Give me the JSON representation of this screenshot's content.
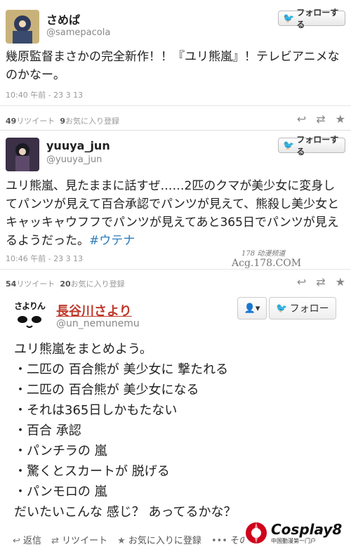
{
  "tweets": [
    {
      "name": "さめぱ",
      "handle": "@samepacola",
      "follow_label": "フォローする",
      "text": "幾原監督まさかの完全新作！！『ユリ熊嵐』！テレビアニメなのかなー。",
      "time": "10:40 午前 - 23 3 13",
      "retweets": "49",
      "retweets_label": "リツイート",
      "favs": "9",
      "favs_label": "お気に入り登録"
    },
    {
      "name": "yuuya_jun",
      "handle": "@yuuya_jun",
      "follow_label": "フォローする",
      "text": "ユリ熊嵐、見たままに話すぜ……2匹のクマが美少女に変身してパンツが見えて百合承認でパンツが見えて、熊殺し美少女とキャッキャウフフでパンツが見えてあと365日でパンツが見えるようだった。",
      "hashtag": "#ウテナ",
      "time": "10:46 午前 - 23 3 13",
      "retweets": "54",
      "retweets_label": "リツイート",
      "favs": "20",
      "favs_label": "お気に入り登録"
    }
  ],
  "watermark": {
    "line1": "178 动漫频道",
    "line2": "Acg.178.COM"
  },
  "tweet3": {
    "name": "長谷川さより",
    "handle": "@un_nemunemu",
    "avatar_text": "さよりん",
    "follow_label": "フォロー",
    "lines": [
      "ユリ熊嵐をまとめよう。",
      "・二匹の 百合熊が 美少女に 撃たれる",
      "・二匹の 百合熊が 美少女になる",
      "・それは365日しかもたない",
      "・百合 承認",
      "・パンチラの 嵐",
      "・驚くとスカートが 脱げる",
      "・パンモロの 嵐",
      "だいたいこんな 感じ？ あってるかな？"
    ],
    "actions": {
      "reply": "返信",
      "retweet": "リツイート",
      "fav": "お気に入りに登録",
      "more": "その他"
    }
  },
  "cosplay_logo": {
    "main": "Cosplay8",
    "sub": "中国動漫第一门户"
  }
}
